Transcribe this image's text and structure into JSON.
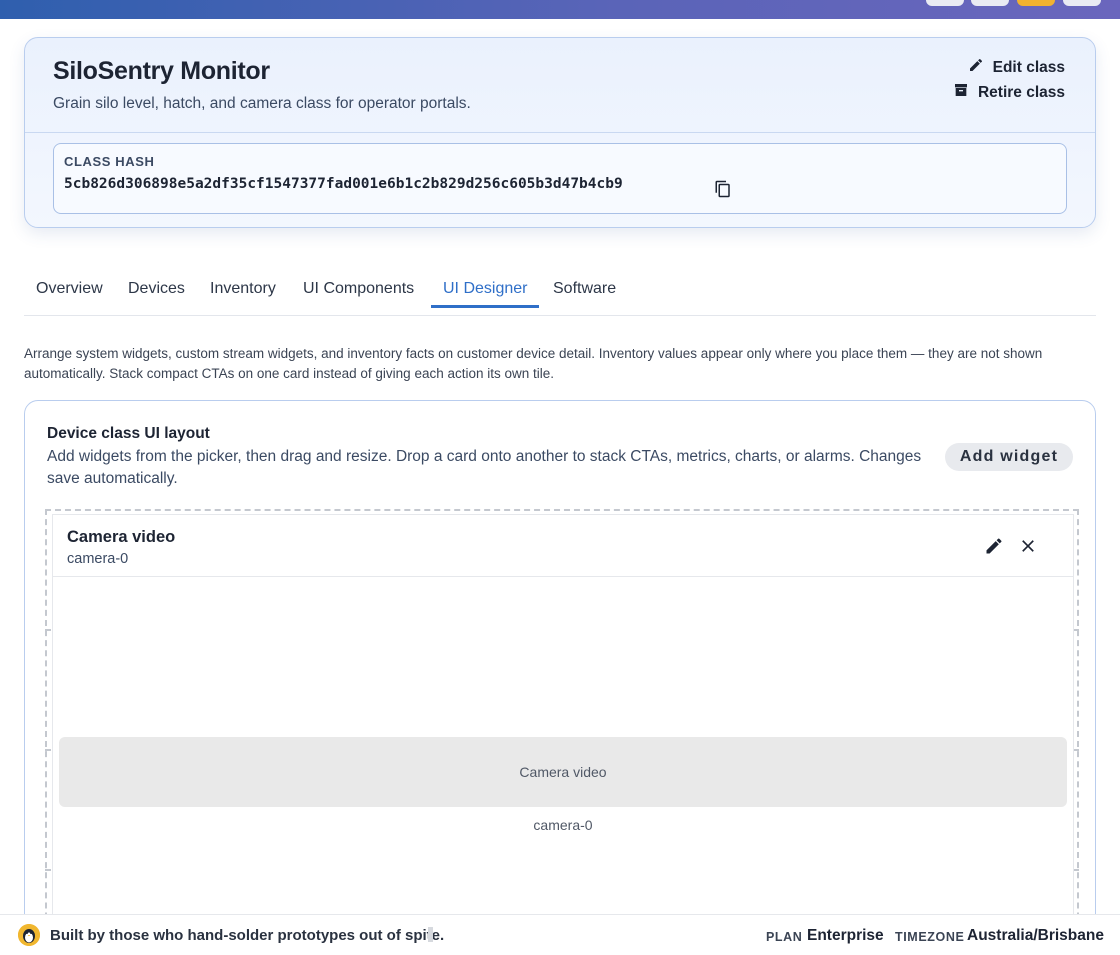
{
  "class_card": {
    "title": "SiloSentry Monitor",
    "description": "Grain silo level, hatch, and camera class for operator portals.",
    "edit_label": "Edit class",
    "retire_label": "Retire class",
    "hash_label": "CLASS HASH",
    "hash_value": "5cb826d306898e5a2df35cf1547377fad001e6b1c2b829d256c605b3d47b4cb9"
  },
  "tabs": [
    {
      "label": "Overview"
    },
    {
      "label": "Devices"
    },
    {
      "label": "Inventory"
    },
    {
      "label": "UI Components"
    },
    {
      "label": "UI Designer",
      "active": true
    },
    {
      "label": "Software"
    }
  ],
  "intro_text": "Arrange system widgets, custom stream widgets, and inventory facts on customer device detail. Inventory values appear only where you place them — they are not shown automatically. Stack compact CTAs on one card instead of giving each action its own tile.",
  "layout": {
    "title": "Device class UI layout",
    "description": "Add widgets from the picker, then drag and resize. Drop a card onto another to stack CTAs, metrics, charts, or alarms. Changes save automatically.",
    "add_widget_label": "Add widget",
    "widget": {
      "title": "Camera video",
      "subtitle": "camera-0",
      "placeholder": "Camera video",
      "caption": "camera-0"
    }
  },
  "footer": {
    "tagline": "Built by those who hand-solder prototypes out of spite.",
    "plan_label": "PLAN",
    "plan_value": "Enterprise",
    "timezone_label": "TIMEZONE",
    "timezone_value": "Australia/Brisbane"
  },
  "colors": {
    "accent": "#2f6fc8",
    "brand_gradient_start": "#2f5fae",
    "brand_gradient_end": "#6a66bd",
    "logo": "#f1b72f"
  }
}
